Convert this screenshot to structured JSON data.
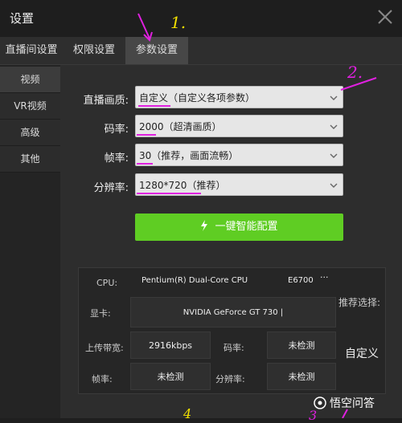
{
  "window": {
    "title": "设置"
  },
  "tabs": [
    {
      "label": "直播间设置"
    },
    {
      "label": "权限设置"
    },
    {
      "label": "参数设置"
    }
  ],
  "sidebar": {
    "items": [
      {
        "label": "视频"
      },
      {
        "label": "VR视频"
      },
      {
        "label": "高级"
      },
      {
        "label": "其他"
      }
    ]
  },
  "settings": {
    "quality": {
      "label": "直播画质:",
      "value": "自定义（自定义各项参数）"
    },
    "bitrate": {
      "label": "码率:",
      "value": "2000（超清画质）"
    },
    "framerate": {
      "label": "帧率:",
      "value": "30（推荐，画面流畅）"
    },
    "resolution": {
      "label": "分辨率:",
      "value": "1280*720（推荐）"
    }
  },
  "smart_config_button": {
    "label": "一键智能配置"
  },
  "hardware": {
    "cpu_label": "CPU:",
    "cpu_value": "Pentium(R) Dual-Core  CPU",
    "cpu_model": "E6700",
    "cpu_more": "···",
    "gpu_label": "显卡:",
    "gpu_value": "NVIDIA GeForce GT 730 |",
    "upload_label": "上传带宽:",
    "upload_value": "2916kbps",
    "bitrate_label": "码率:",
    "bitrate_value": "未检测",
    "framerate_label": "帧率:",
    "framerate_value": "未检测",
    "resolution_label": "分辨率:",
    "resolution_value": "未检测",
    "recommend_label": "推荐选择:",
    "recommend_value": "自定义"
  },
  "annotations": {
    "num1": "1.",
    "num2": "2.",
    "num3": "3",
    "num4": "4"
  },
  "watermark": {
    "text": "悟空问答"
  },
  "colors": {
    "accent_green": "#5fcd23",
    "annotation_pink": "#e020e0",
    "annotation_yellow": "#f2e000"
  }
}
